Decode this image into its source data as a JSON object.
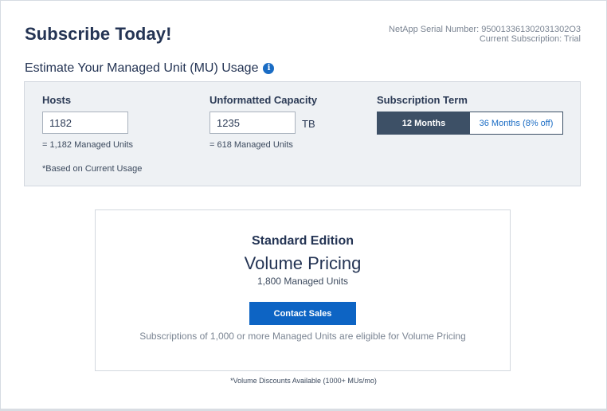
{
  "header": {
    "title": "Subscribe Today!",
    "serial_line": "NetApp Serial Number: 950013361302031302O3",
    "subscription_line": "Current Subscription: Trial"
  },
  "estimate": {
    "heading": "Estimate Your Managed Unit (MU) Usage",
    "info_icon": "i",
    "hosts": {
      "label": "Hosts",
      "value": "1182",
      "helper": "= 1,182 Managed Units"
    },
    "capacity": {
      "label": "Unformatted Capacity",
      "value": "1235",
      "unit": "TB",
      "helper": "= 618 Managed Units"
    },
    "term": {
      "label": "Subscription Term",
      "options": [
        "12 Months",
        "36 Months (8% off)"
      ],
      "selected": "12 Months"
    },
    "usage_note": "*Based on Current Usage"
  },
  "pricing": {
    "edition": "Standard Edition",
    "type": "Volume Pricing",
    "managed_units": "1,800 Managed Units",
    "contact_label": "Contact Sales",
    "eligibility": "Subscriptions of 1,000 or more Managed Units are eligible for Volume Pricing"
  },
  "footnote": "*Volume Discounts Available (1000+ MUs/mo)",
  "colors": {
    "primary": "#0d64c4",
    "toggle_active": "#3d5066",
    "panel_bg": "#eef1f4",
    "heading": "#243454"
  }
}
